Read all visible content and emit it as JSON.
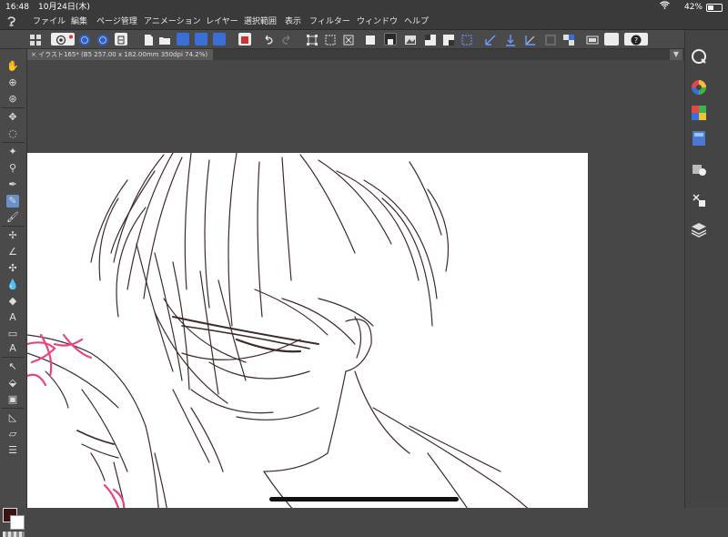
{
  "status_bar": {
    "time": "16:48",
    "date": "10月24日(木)",
    "battery": "42%"
  },
  "menu": {
    "items": [
      "ファイル",
      "編集",
      "ページ管理",
      "アニメーション",
      "レイヤー",
      "選択範囲",
      "表示",
      "フィルター",
      "ウィンドウ",
      "ヘルプ"
    ]
  },
  "document_tab": {
    "label": "イラスト165* (B5 257.00 x 182.00mm 350dpi 74.2%)"
  },
  "tools": {
    "text_tool_glyph": "A",
    "text_tool_glyph_2": "A"
  },
  "colors": {
    "main_color": "#3a1212",
    "sub_color": "#ffffff",
    "sketch_line": "#2a1414",
    "pink_line": "#e8457a"
  }
}
